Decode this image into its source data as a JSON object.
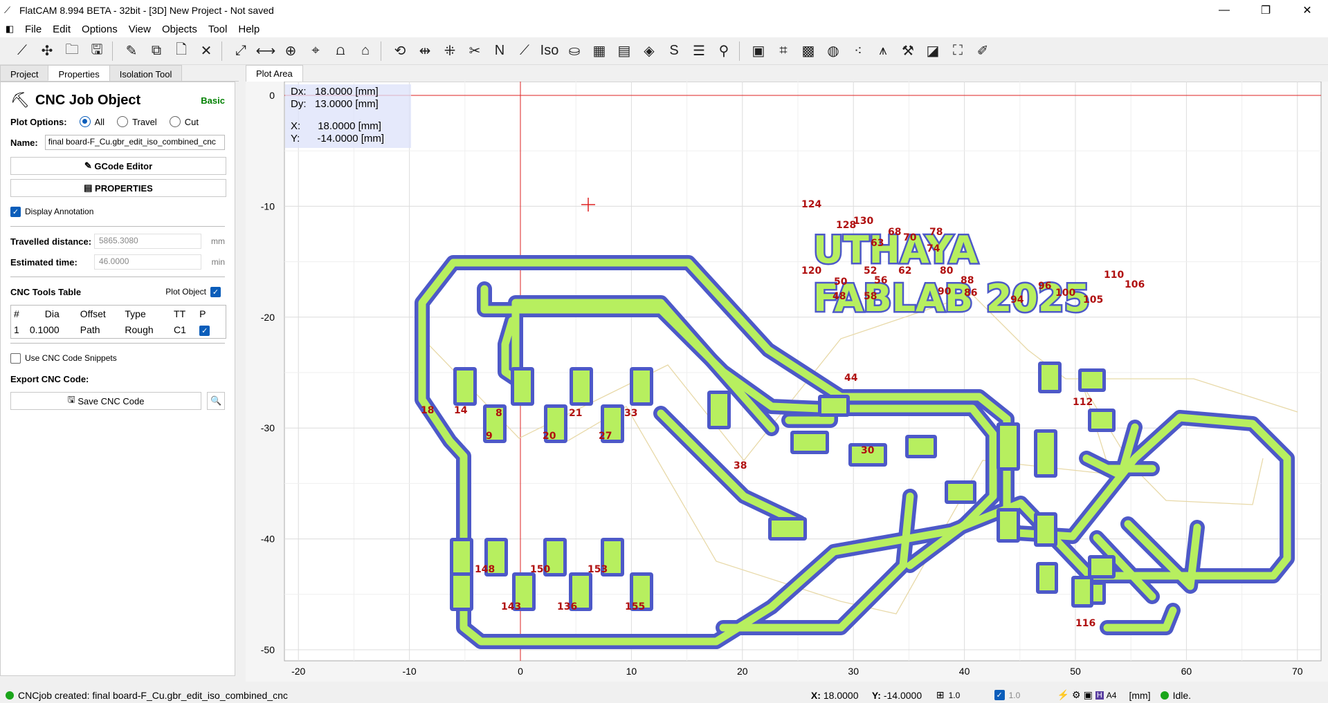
{
  "titlebar": {
    "title": "FlatCAM 8.994 BETA - 32bit - [3D]    New Project - Not saved"
  },
  "menus": [
    "File",
    "Edit",
    "Options",
    "View",
    "Objects",
    "Tool",
    "Help"
  ],
  "tabs": {
    "project": "Project",
    "properties": "Properties",
    "isolation": "Isolation Tool"
  },
  "panel": {
    "title": "CNC Job Object",
    "level": "Basic",
    "plot_options_label": "Plot Options:",
    "opt_all": "All",
    "opt_travel": "Travel",
    "opt_cut": "Cut",
    "name_label": "Name:",
    "name_value": "final board-F_Cu.gbr_edit_iso_combined_cnc",
    "gcode_editor": "GCode Editor",
    "properties_btn": "PROPERTIES",
    "display_annotation": "Display Annotation",
    "travelled_label": "Travelled distance:",
    "travelled_value": "5865.3080",
    "travelled_unit": "mm",
    "time_label": "Estimated time:",
    "time_value": "46.0000",
    "time_unit": "min",
    "tools_table_label": "CNC Tools Table",
    "plot_object": "Plot Object",
    "table_headers": [
      "#",
      "Dia",
      "Offset",
      "Type",
      "TT",
      "P"
    ],
    "table_row": [
      "1",
      "0.1000",
      "Path",
      "Rough",
      "C1"
    ],
    "use_snippets": "Use CNC Code Snippets",
    "export_label": "Export CNC Code:",
    "save_btn": "Save CNC Code"
  },
  "plot": {
    "tab": "Plot Area",
    "dx_label": "Dx:",
    "dx": "18.0000 [mm]",
    "dy_label": "Dy:",
    "dy": "13.0000 [mm]",
    "x_label": "X:",
    "x": "18.0000 [mm]",
    "y_label": "Y:",
    "y": "-14.0000 [mm]",
    "x_ticks": [
      "-20",
      "-10",
      "0",
      "10",
      "20",
      "30",
      "40",
      "50",
      "60",
      "70"
    ],
    "y_ticks": [
      "0",
      "-10",
      "-20",
      "-30",
      "-40",
      "-50"
    ],
    "board_text_1": "UTHAYA",
    "board_text_2": "FABLAB  2025",
    "annotations": [
      "124",
      "128",
      "130",
      "63",
      "68",
      "70",
      "78",
      "74",
      "120",
      "52",
      "56",
      "62",
      "80",
      "88",
      "50",
      "48",
      "58",
      "90",
      "86",
      "94",
      "96",
      "100",
      "105",
      "110",
      "106",
      "44",
      "112",
      "18",
      "14",
      "8",
      "9",
      "20",
      "21",
      "27",
      "33",
      "30",
      "38",
      "148",
      "150",
      "153",
      "143",
      "136",
      "155",
      "116"
    ]
  },
  "status": {
    "message": "CNCjob created: final board-F_Cu.gbr_edit_iso_combined_cnc",
    "x_label": "X:",
    "x": "18.0000",
    "y_label": "Y:",
    "y": "-14.0000",
    "grid1": "1.0",
    "grid2": "1.0",
    "sheet": "A4",
    "units": "[mm]",
    "state": "Idle."
  }
}
